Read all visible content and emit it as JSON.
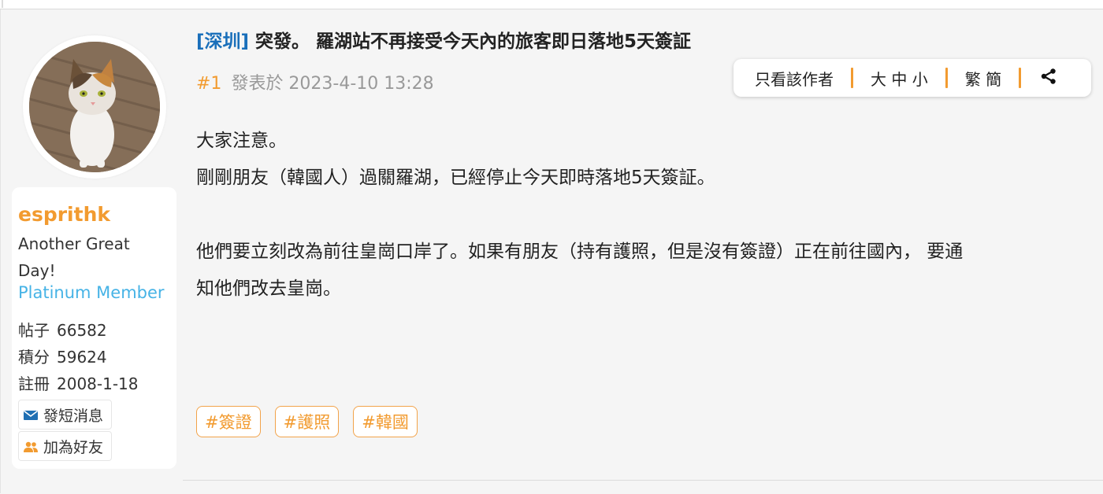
{
  "thread": {
    "forum_tag": "[深圳]",
    "title": "突發。 羅湖站不再接受今天內的旅客即日落地5天簽証"
  },
  "post": {
    "floor": "#1",
    "posted_at": "發表於 2023-4-10 13:28",
    "body": {
      "line1": "大家注意。",
      "line2": "剛剛朋友（韓國人）過關羅湖，已經停止今天即時落地5天簽証。",
      "line3": "他們要立刻改為前往皇崗口岸了。如果有朋友（持有護照，但是沒有簽證）正在前往國內，  要通",
      "line4": "知他們改去皇崗。"
    },
    "tags": [
      "#簽證",
      "#護照",
      "#韓國"
    ]
  },
  "toolbar": {
    "author_only": "只看該作者",
    "font_size": "大 中 小",
    "trad_simp": "繁 簡",
    "share_icon": "share-icon"
  },
  "user": {
    "username": "esprithk",
    "tagline": "Another Great Day!",
    "rank": "Platinum Member",
    "stats": {
      "posts_label": "帖子",
      "posts_value": "66582",
      "credits_label": "積分",
      "credits_value": "59624",
      "registered_label": "註冊",
      "registered_value": "2008-1-18"
    },
    "send_pm": "發短消息",
    "add_friend": "加為好友"
  },
  "colors": {
    "accent_orange": "#f29b30",
    "rank_blue": "#46b3e6",
    "forum_link_blue": "#1a6fba",
    "page_bg": "#f5f5f5"
  }
}
